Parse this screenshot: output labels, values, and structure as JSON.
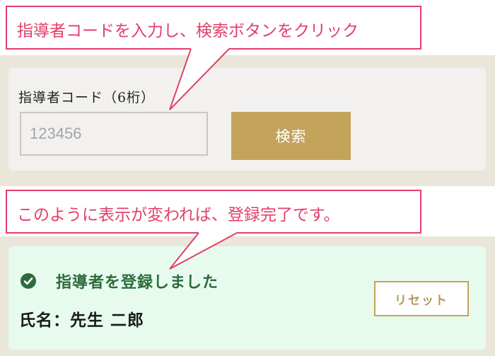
{
  "callouts": {
    "search_instruction": "指導者コードを入力し、検索ボタンをクリック",
    "result_instruction": "このように表示が変われば、登録完了です。"
  },
  "search_form": {
    "label": "指導者コード（6桁）",
    "input_placeholder": "123456",
    "input_value": "",
    "search_button": "検索"
  },
  "result": {
    "icon": "check-circle-icon",
    "message": "指導者を登録しました",
    "name": "氏名：先生 二郎",
    "reset_button": "リセット"
  },
  "colors": {
    "accent_gold": "#c4a35a",
    "callout_pink": "#e23f6b",
    "success_green": "#2c6b3c",
    "success_bg": "#e6fbee",
    "band_beige": "#ebe6da"
  }
}
